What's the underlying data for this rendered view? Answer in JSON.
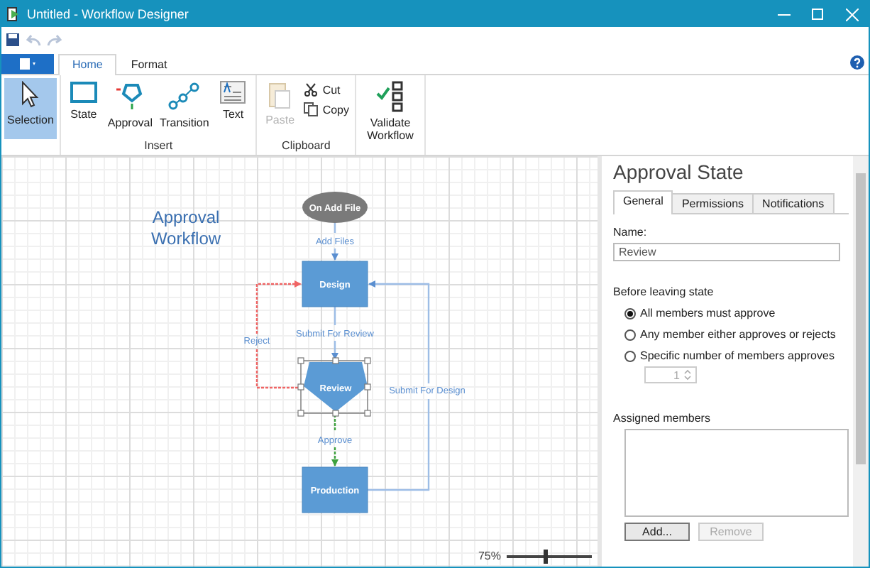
{
  "window": {
    "title": "Untitled - Workflow Designer"
  },
  "quick_access": [
    {
      "kind": "save",
      "disabled": false
    },
    {
      "kind": "undo",
      "disabled": true
    },
    {
      "kind": "redo",
      "disabled": true
    }
  ],
  "ribbon_tabs": [
    {
      "label": "Home",
      "selected": true
    },
    {
      "label": "Format",
      "selected": false
    }
  ],
  "ribbon_groups": [
    {
      "items": [
        {
          "kind": "selection",
          "label": "Selection",
          "selected": true
        }
      ]
    },
    {
      "label": "Insert",
      "items": [
        {
          "kind": "state",
          "label": "State",
          "selected": false
        },
        {
          "kind": "approval",
          "label": "Approval",
          "selected": false
        },
        {
          "kind": "transition",
          "label": "Transition",
          "selected": false
        },
        {
          "kind": "text",
          "label": "Text",
          "selected": false
        }
      ]
    },
    {
      "label": "Clipboard",
      "items": [
        {
          "kind": "paste",
          "label": "Paste",
          "disabled": true
        },
        {
          "kind": "cut",
          "label": "Cut",
          "disabled": false
        },
        {
          "kind": "copy",
          "label": "Copy",
          "disabled": false
        }
      ]
    },
    {
      "items": [
        {
          "kind": "validate",
          "label": "Validate Workflow",
          "selected": false
        }
      ]
    }
  ],
  "diagram": {
    "title": "Approval Workflow",
    "nodes": [
      {
        "kind": "event",
        "label": "On Add File",
        "selected": false
      },
      {
        "kind": "state",
        "label": "Design",
        "selected": false
      },
      {
        "kind": "approval",
        "label": "Review",
        "selected": true
      },
      {
        "kind": "state",
        "label": "Production",
        "selected": false
      }
    ],
    "transitions": [
      {
        "kind": "normal",
        "label": "Add Files"
      },
      {
        "kind": "normal",
        "label": "Submit For Review"
      },
      {
        "kind": "reject",
        "label": "Reject"
      },
      {
        "kind": "approve",
        "label": "Approve"
      },
      {
        "kind": "normal",
        "label": "Submit For Design"
      }
    ]
  },
  "zoom": {
    "reading": "75%",
    "level": 0.45
  },
  "properties": {
    "title": "Approval State",
    "tabs": [
      {
        "label": "General",
        "selected": true
      },
      {
        "label": "Permissions",
        "selected": false
      },
      {
        "label": "Notifications",
        "selected": false
      }
    ],
    "name_label": "Name:",
    "name_value": "Review",
    "section_label": "Before leaving state",
    "options": [
      {
        "label": "All members must approve",
        "selected": true
      },
      {
        "label": "Any member either approves or rejects",
        "selected": false
      },
      {
        "label": "Specific number of members approves",
        "selected": false
      }
    ],
    "spinner": {
      "value": "1",
      "disabled": true
    },
    "members_label": "Assigned members",
    "buttons": [
      {
        "label": "Add...",
        "disabled": false
      },
      {
        "label": "Remove",
        "disabled": true
      }
    ]
  }
}
